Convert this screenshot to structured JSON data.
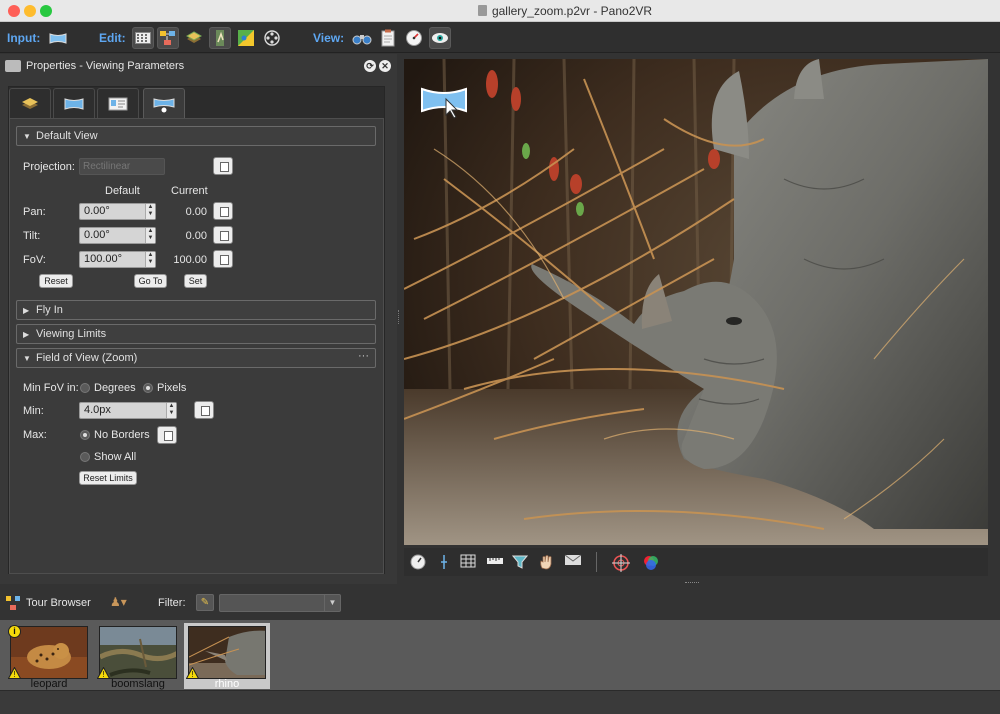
{
  "window": {
    "title": "gallery_zoom.p2vr - Pano2VR"
  },
  "toolbar": {
    "input_label": "Input:",
    "edit_label": "Edit:",
    "view_label": "View:",
    "input_icons": [
      "panorama-input-icon"
    ],
    "edit_icons": [
      "viewing-parameters-icon",
      "tour-map-icon",
      "layers-icon",
      "patch-icon",
      "maps-icon",
      "media-icon"
    ],
    "view_icons": [
      "binoculars-icon",
      "clipboard-icon",
      "compass-icon",
      "eye-icon"
    ]
  },
  "properties": {
    "title": "Properties - Viewing Parameters",
    "tabs": [
      "layers-tab",
      "panorama-tab",
      "info-tab",
      "viewing-parameters-tab"
    ],
    "active_tab": 3
  },
  "default_view": {
    "section_title": "Default View",
    "projection_label": "Projection:",
    "projection_value": "Rectilinear",
    "col_default": "Default",
    "col_current": "Current",
    "rows": [
      {
        "label": "Pan:",
        "default": "0.00°",
        "current": "0.00"
      },
      {
        "label": "Tilt:",
        "default": "0.00°",
        "current": "0.00"
      },
      {
        "label": "FoV:",
        "default": "100.00°",
        "current": "100.00"
      }
    ],
    "reset_label": "Reset",
    "goto_label": "Go To",
    "set_label": "Set"
  },
  "fly_in": {
    "section_title": "Fly In"
  },
  "viewing_limits": {
    "section_title": "Viewing Limits"
  },
  "fov_zoom": {
    "section_title": "Field of View (Zoom)",
    "dots": "···",
    "min_fov_in_label": "Min FoV in:",
    "degrees_label": "Degrees",
    "pixels_label": "Pixels",
    "min_fov_unit_selected": "Pixels",
    "min_label": "Min:",
    "min_value": "4.0px",
    "max_label": "Max:",
    "no_borders_label": "No Borders",
    "show_all_label": "Show All",
    "max_selected": "No Borders",
    "reset_limits_label": "Reset Limits"
  },
  "viewer_toolbar": {
    "icons": [
      "compass-icon",
      "crosshair-icon",
      "grid-icon",
      "ruler-icon",
      "funnel-icon",
      "hand-icon",
      "envelope-map-icon",
      "target-icon",
      "color-wheel-icon"
    ]
  },
  "tour_browser": {
    "title": "Tour Browser",
    "filter_label": "Filter:",
    "filter_value": "",
    "nodes": [
      {
        "name": "leopard",
        "selected": false,
        "start_node": true,
        "warning": true
      },
      {
        "name": "boomslang",
        "selected": false,
        "start_node": false,
        "warning": true
      },
      {
        "name": "rhino",
        "selected": true,
        "start_node": false,
        "warning": true
      }
    ]
  },
  "colors": {
    "accent": "#5ea7f2",
    "panel_bg": "#3b3b3b",
    "window_bg": "#333333",
    "selection": "#c9c9c9",
    "warning": "#f5d90a"
  }
}
